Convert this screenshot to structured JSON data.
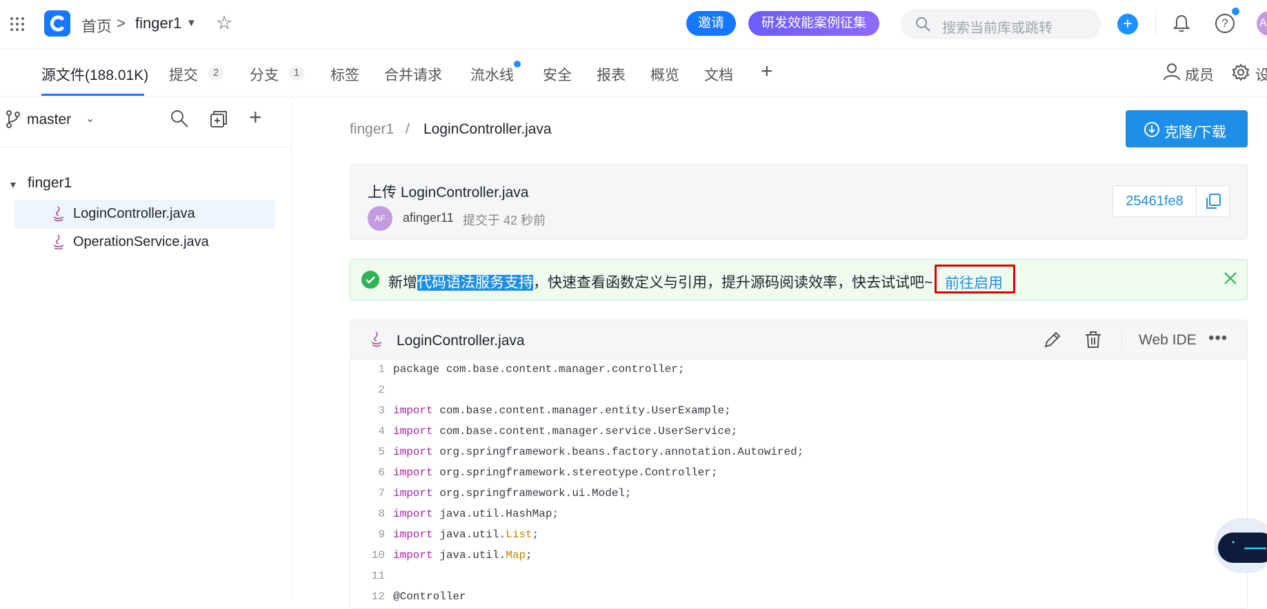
{
  "topbar": {
    "breadcrumb_home": "首页",
    "breadcrumb_sep": ">",
    "repo_name": "finger1",
    "invite_label": "邀请",
    "case_label": "研发效能案例征集",
    "search_placeholder": "搜索当前库或跳转",
    "avatar_initial": "A"
  },
  "tabs": {
    "items": [
      {
        "label": "源文件(188.01K)"
      },
      {
        "label": "提交",
        "badge": "2"
      },
      {
        "label": "分支",
        "badge": "1"
      },
      {
        "label": "标签"
      },
      {
        "label": "合并请求"
      },
      {
        "label": "流水线"
      },
      {
        "label": "安全"
      },
      {
        "label": "报表"
      },
      {
        "label": "概览"
      },
      {
        "label": "文档"
      }
    ],
    "members_label": "成员",
    "settings_label": "设"
  },
  "sidebar": {
    "branch": "master",
    "root": "finger1",
    "files": [
      {
        "name": "LoginController.java"
      },
      {
        "name": "OperationService.java"
      }
    ]
  },
  "main": {
    "path_repo": "finger1",
    "path_sep": "/",
    "path_file": "LoginController.java",
    "clone_label": "克隆/下载",
    "commit": {
      "message": "上传 LoginController.java",
      "avatar_initials": "AF",
      "author": "afinger11",
      "time": "提交于 42 秒前",
      "hash": "25461fe8"
    },
    "notice": {
      "prefix": "新增",
      "highlight": "代码语法服务支持",
      "suffix": "，快速查看函数定义与引用，提升源码阅读效率，快去试试吧~",
      "link": "前往启用"
    },
    "file": {
      "name": "LoginController.java",
      "webide_label": "Web IDE",
      "lines": [
        {
          "n": "1",
          "kw": "",
          "code": "package com.base.content.manager.controller;",
          "type": "",
          "tail": ""
        },
        {
          "n": "2",
          "kw": "",
          "code": "",
          "type": "",
          "tail": ""
        },
        {
          "n": "3",
          "kw": "import",
          "code": " com.base.content.manager.entity.UserExample;",
          "type": "",
          "tail": ""
        },
        {
          "n": "4",
          "kw": "import",
          "code": " com.base.content.manager.service.UserService;",
          "type": "",
          "tail": ""
        },
        {
          "n": "5",
          "kw": "import",
          "code": " org.springframework.beans.factory.annotation.Autowired;",
          "type": "",
          "tail": ""
        },
        {
          "n": "6",
          "kw": "import",
          "code": " org.springframework.stereotype.Controller;",
          "type": "",
          "tail": ""
        },
        {
          "n": "7",
          "kw": "import",
          "code": " org.springframework.ui.Model;",
          "type": "",
          "tail": ""
        },
        {
          "n": "8",
          "kw": "import",
          "code": " java.util.HashMap;",
          "type": "",
          "tail": ""
        },
        {
          "n": "9",
          "kw": "import",
          "code": " java.util.",
          "type": "List",
          "tail": ";"
        },
        {
          "n": "10",
          "kw": "import",
          "code": " java.util.",
          "type": "Map",
          "tail": ";"
        },
        {
          "n": "11",
          "kw": "",
          "code": "",
          "type": "",
          "tail": ""
        },
        {
          "n": "12",
          "kw": "",
          "code": "@Controller",
          "type": "",
          "tail": ""
        }
      ]
    }
  },
  "colors": {
    "accent": "#1e8ee6",
    "keyword": "#a626a4",
    "type": "#c18401",
    "notice_border": "#d60000"
  },
  "icons": [
    "apps-grid-icon",
    "logo-icon",
    "star-icon",
    "search-icon",
    "plus-icon",
    "bell-icon",
    "help-icon",
    "branch-icon",
    "compare-icon",
    "java-file-icon",
    "download-icon",
    "copy-icon",
    "check-circle-icon",
    "close-icon",
    "edit-icon",
    "trash-icon",
    "more-icon",
    "user-icon",
    "gear-icon"
  ]
}
